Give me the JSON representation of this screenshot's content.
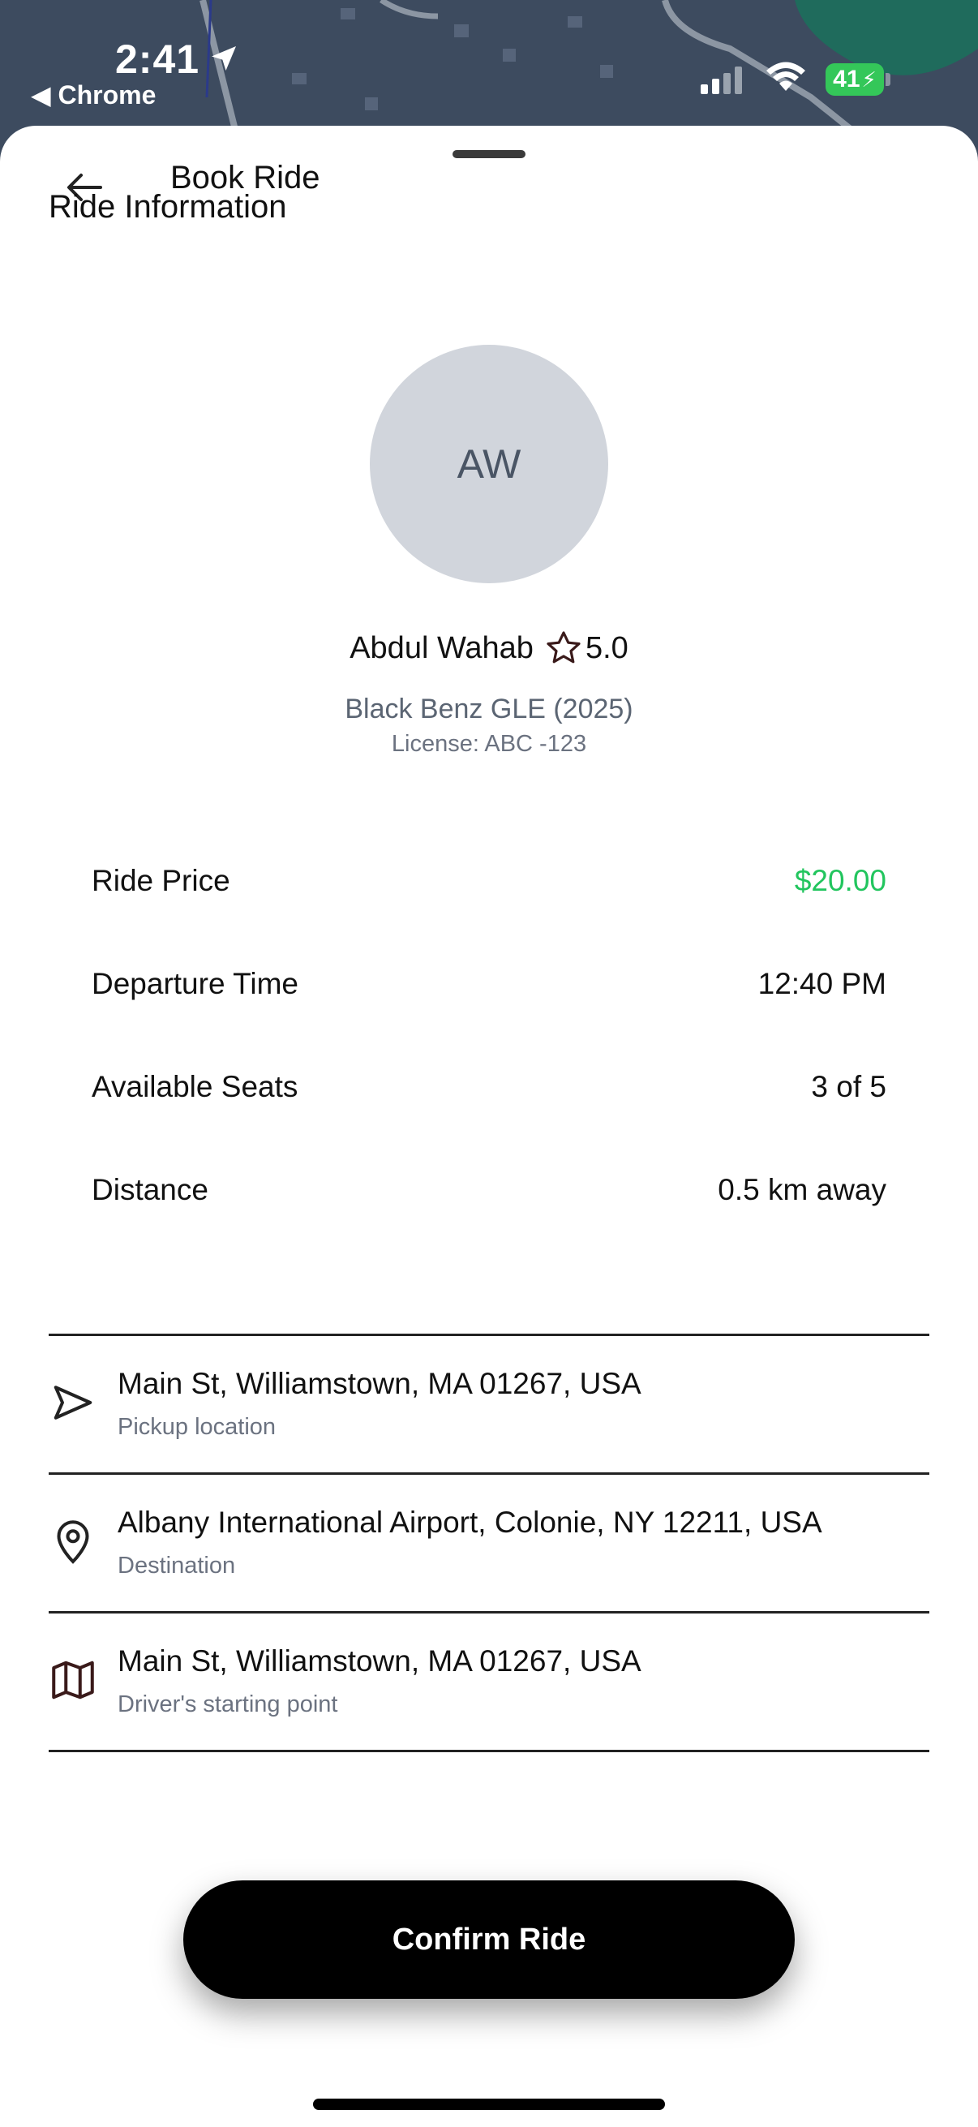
{
  "status_bar": {
    "time": "2:41",
    "back_app": "◀ Chrome",
    "battery": "41"
  },
  "header": {
    "title": "Book Ride",
    "section_title": "Ride Information"
  },
  "driver": {
    "initials": "AW",
    "name": "Abdul Wahab",
    "rating": "5.0",
    "vehicle": "Black Benz GLE (2025)",
    "license": "License: ABC -123"
  },
  "details": [
    {
      "label": "Ride Price",
      "value": "$20.00"
    },
    {
      "label": "Departure Time",
      "value": "12:40 PM"
    },
    {
      "label": "Available Seats",
      "value": "3 of 5"
    },
    {
      "label": "Distance",
      "value": "0.5 km away"
    }
  ],
  "locations": [
    {
      "address": "Main St, Williamstown, MA 01267, USA",
      "caption": "Pickup location",
      "icon": "navigation-icon"
    },
    {
      "address": "Albany International Airport, Colonie, NY 12211, USA",
      "caption": "Destination",
      "icon": "map-pin-icon"
    },
    {
      "address": "Main St, Williamstown, MA 01267, USA",
      "caption": "Driver's starting point",
      "icon": "map-icon"
    }
  ],
  "actions": {
    "confirm_label": "Confirm Ride"
  },
  "colors": {
    "price": "#22c55e",
    "avatar_bg": "#d1d5dc",
    "button_bg": "#000000"
  }
}
